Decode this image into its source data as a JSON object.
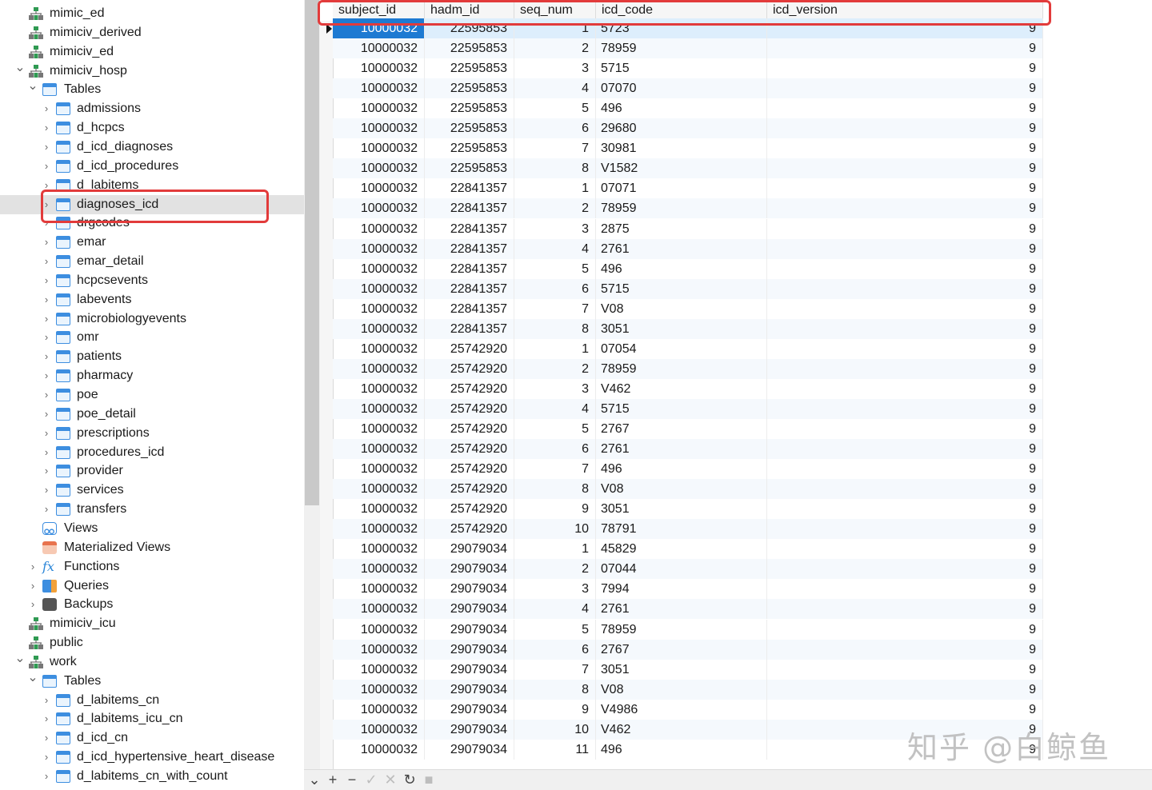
{
  "tree": {
    "items": [
      {
        "label": "mimic_ed",
        "icon": "schema-icon",
        "level": 1,
        "chevron": "",
        "selected": false
      },
      {
        "label": "mimiciv_derived",
        "icon": "schema-icon",
        "level": 1,
        "chevron": "",
        "selected": false
      },
      {
        "label": "mimiciv_ed",
        "icon": "schema-icon",
        "level": 1,
        "chevron": "",
        "selected": false
      },
      {
        "label": "mimiciv_hosp",
        "icon": "schema-icon",
        "level": 1,
        "chevron": "down",
        "selected": false
      },
      {
        "label": "Tables",
        "icon": "tables-folder-icon",
        "level": 2,
        "chevron": "down",
        "selected": false
      },
      {
        "label": "admissions",
        "icon": "table-icon",
        "level": 3,
        "chevron": "right",
        "selected": false
      },
      {
        "label": "d_hcpcs",
        "icon": "table-icon",
        "level": 3,
        "chevron": "right",
        "selected": false
      },
      {
        "label": "d_icd_diagnoses",
        "icon": "table-icon",
        "level": 3,
        "chevron": "right",
        "selected": false
      },
      {
        "label": "d_icd_procedures",
        "icon": "table-icon",
        "level": 3,
        "chevron": "right",
        "selected": false
      },
      {
        "label": "d_labitems",
        "icon": "table-icon",
        "level": 3,
        "chevron": "right",
        "selected": false
      },
      {
        "label": "diagnoses_icd",
        "icon": "table-icon",
        "level": 3,
        "chevron": "right",
        "selected": true
      },
      {
        "label": "drgcodes",
        "icon": "table-icon",
        "level": 3,
        "chevron": "right",
        "selected": false
      },
      {
        "label": "emar",
        "icon": "table-icon",
        "level": 3,
        "chevron": "right",
        "selected": false
      },
      {
        "label": "emar_detail",
        "icon": "table-icon",
        "level": 3,
        "chevron": "right",
        "selected": false
      },
      {
        "label": "hcpcsevents",
        "icon": "table-icon",
        "level": 3,
        "chevron": "right",
        "selected": false
      },
      {
        "label": "labevents",
        "icon": "table-icon",
        "level": 3,
        "chevron": "right",
        "selected": false
      },
      {
        "label": "microbiologyevents",
        "icon": "table-icon",
        "level": 3,
        "chevron": "right",
        "selected": false
      },
      {
        "label": "omr",
        "icon": "table-icon",
        "level": 3,
        "chevron": "right",
        "selected": false
      },
      {
        "label": "patients",
        "icon": "table-icon",
        "level": 3,
        "chevron": "right",
        "selected": false
      },
      {
        "label": "pharmacy",
        "icon": "table-icon",
        "level": 3,
        "chevron": "right",
        "selected": false
      },
      {
        "label": "poe",
        "icon": "table-icon",
        "level": 3,
        "chevron": "right",
        "selected": false
      },
      {
        "label": "poe_detail",
        "icon": "table-icon",
        "level": 3,
        "chevron": "right",
        "selected": false
      },
      {
        "label": "prescriptions",
        "icon": "table-icon",
        "level": 3,
        "chevron": "right",
        "selected": false
      },
      {
        "label": "procedures_icd",
        "icon": "table-icon",
        "level": 3,
        "chevron": "right",
        "selected": false
      },
      {
        "label": "provider",
        "icon": "table-icon",
        "level": 3,
        "chevron": "right",
        "selected": false
      },
      {
        "label": "services",
        "icon": "table-icon",
        "level": 3,
        "chevron": "right",
        "selected": false
      },
      {
        "label": "transfers",
        "icon": "table-icon",
        "level": 3,
        "chevron": "right",
        "selected": false
      },
      {
        "label": "Views",
        "icon": "views-icon",
        "level": 2,
        "chevron": "",
        "selected": false
      },
      {
        "label": "Materialized Views",
        "icon": "materialized-views-icon",
        "level": 2,
        "chevron": "",
        "selected": false
      },
      {
        "label": "Functions",
        "icon": "function-icon",
        "level": 2,
        "chevron": "right",
        "selected": false
      },
      {
        "label": "Queries",
        "icon": "queries-icon",
        "level": 2,
        "chevron": "right",
        "selected": false
      },
      {
        "label": "Backups",
        "icon": "backup-icon",
        "level": 2,
        "chevron": "right",
        "selected": false
      },
      {
        "label": "mimiciv_icu",
        "icon": "schema-icon",
        "level": 1,
        "chevron": "",
        "selected": false
      },
      {
        "label": "public",
        "icon": "schema-icon",
        "level": 1,
        "chevron": "",
        "selected": false
      },
      {
        "label": "work",
        "icon": "schema-icon",
        "level": 1,
        "chevron": "down",
        "selected": false
      },
      {
        "label": "Tables",
        "icon": "tables-folder-icon",
        "level": 2,
        "chevron": "down",
        "selected": false
      },
      {
        "label": "d_labitems_cn",
        "icon": "table-icon",
        "level": 3,
        "chevron": "right",
        "selected": false
      },
      {
        "label": "d_labitems_icu_cn",
        "icon": "table-icon",
        "level": 3,
        "chevron": "right",
        "selected": false
      },
      {
        "label": "d_icd_cn",
        "icon": "table-icon",
        "level": 3,
        "chevron": "right",
        "selected": false
      },
      {
        "label": "d_icd_hypertensive_heart_disease",
        "icon": "table-icon",
        "level": 3,
        "chevron": "right",
        "selected": false
      },
      {
        "label": "d_labitems_cn_with_count",
        "icon": "table-icon",
        "level": 3,
        "chevron": "right",
        "selected": false
      }
    ]
  },
  "grid": {
    "columns": [
      "subject_id",
      "hadm_id",
      "seq_num",
      "icd_code",
      "icd_version"
    ],
    "rows": [
      [
        "10000032",
        "22595853",
        "1",
        "5723",
        "9"
      ],
      [
        "10000032",
        "22595853",
        "2",
        "78959",
        "9"
      ],
      [
        "10000032",
        "22595853",
        "3",
        "5715",
        "9"
      ],
      [
        "10000032",
        "22595853",
        "4",
        "07070",
        "9"
      ],
      [
        "10000032",
        "22595853",
        "5",
        "496",
        "9"
      ],
      [
        "10000032",
        "22595853",
        "6",
        "29680",
        "9"
      ],
      [
        "10000032",
        "22595853",
        "7",
        "30981",
        "9"
      ],
      [
        "10000032",
        "22595853",
        "8",
        "V1582",
        "9"
      ],
      [
        "10000032",
        "22841357",
        "1",
        "07071",
        "9"
      ],
      [
        "10000032",
        "22841357",
        "2",
        "78959",
        "9"
      ],
      [
        "10000032",
        "22841357",
        "3",
        "2875",
        "9"
      ],
      [
        "10000032",
        "22841357",
        "4",
        "2761",
        "9"
      ],
      [
        "10000032",
        "22841357",
        "5",
        "496",
        "9"
      ],
      [
        "10000032",
        "22841357",
        "6",
        "5715",
        "9"
      ],
      [
        "10000032",
        "22841357",
        "7",
        "V08",
        "9"
      ],
      [
        "10000032",
        "22841357",
        "8",
        "3051",
        "9"
      ],
      [
        "10000032",
        "25742920",
        "1",
        "07054",
        "9"
      ],
      [
        "10000032",
        "25742920",
        "2",
        "78959",
        "9"
      ],
      [
        "10000032",
        "25742920",
        "3",
        "V462",
        "9"
      ],
      [
        "10000032",
        "25742920",
        "4",
        "5715",
        "9"
      ],
      [
        "10000032",
        "25742920",
        "5",
        "2767",
        "9"
      ],
      [
        "10000032",
        "25742920",
        "6",
        "2761",
        "9"
      ],
      [
        "10000032",
        "25742920",
        "7",
        "496",
        "9"
      ],
      [
        "10000032",
        "25742920",
        "8",
        "V08",
        "9"
      ],
      [
        "10000032",
        "25742920",
        "9",
        "3051",
        "9"
      ],
      [
        "10000032",
        "25742920",
        "10",
        "78791",
        "9"
      ],
      [
        "10000032",
        "29079034",
        "1",
        "45829",
        "9"
      ],
      [
        "10000032",
        "29079034",
        "2",
        "07044",
        "9"
      ],
      [
        "10000032",
        "29079034",
        "3",
        "7994",
        "9"
      ],
      [
        "10000032",
        "29079034",
        "4",
        "2761",
        "9"
      ],
      [
        "10000032",
        "29079034",
        "5",
        "78959",
        "9"
      ],
      [
        "10000032",
        "29079034",
        "6",
        "2767",
        "9"
      ],
      [
        "10000032",
        "29079034",
        "7",
        "3051",
        "9"
      ],
      [
        "10000032",
        "29079034",
        "8",
        "V08",
        "9"
      ],
      [
        "10000032",
        "29079034",
        "9",
        "V4986",
        "9"
      ],
      [
        "10000032",
        "29079034",
        "10",
        "V462",
        "9"
      ],
      [
        "10000032",
        "29079034",
        "11",
        "496",
        "9"
      ]
    ]
  },
  "toolbar": {
    "buttons": [
      {
        "name": "collapse-chevron-icon",
        "glyph": "⌄",
        "disabled": false
      },
      {
        "name": "add-record-button",
        "glyph": "+",
        "disabled": false
      },
      {
        "name": "delete-record-button",
        "glyph": "−",
        "disabled": false
      },
      {
        "name": "apply-changes-button",
        "glyph": "✓",
        "disabled": true
      },
      {
        "name": "discard-changes-button",
        "glyph": "✕",
        "disabled": true
      },
      {
        "name": "refresh-button",
        "glyph": "↻",
        "disabled": false
      },
      {
        "name": "stop-button",
        "glyph": "■",
        "disabled": true
      }
    ]
  },
  "watermark": "知乎 @白鲸鱼",
  "colors": {
    "accent": "#1e7ad2",
    "highlight_box": "#e23b3b",
    "table_icon": "#3d8ee0",
    "schema_icon": "#2f9a52"
  }
}
